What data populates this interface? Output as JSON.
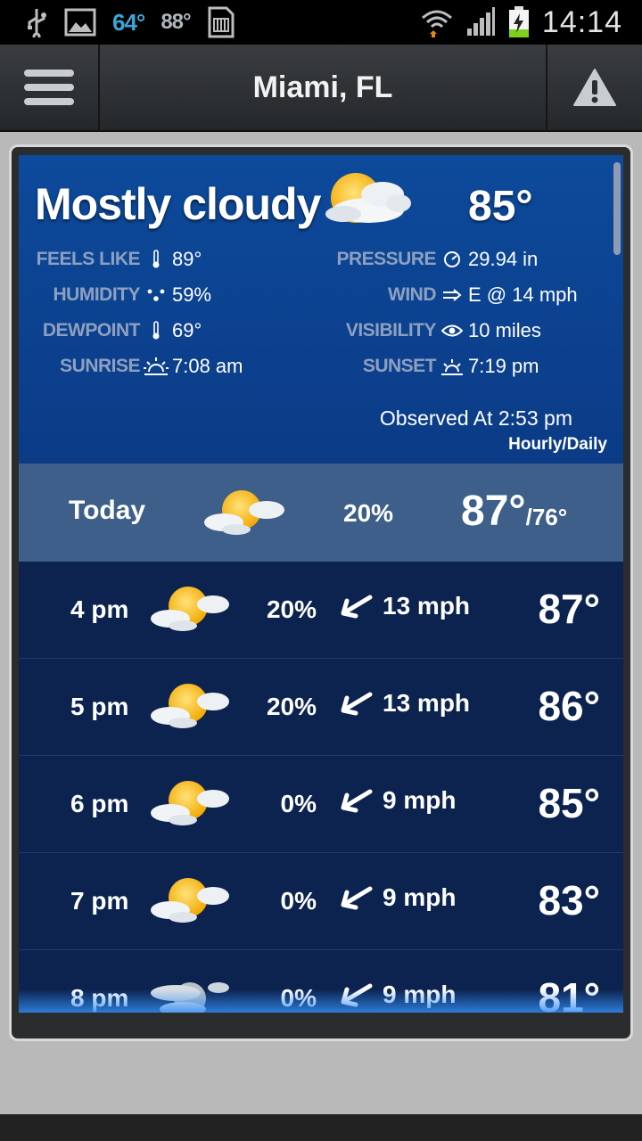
{
  "status_bar": {
    "temp_primary": "64°",
    "temp_secondary": "88°",
    "time": "14:14",
    "icons": [
      "usb-icon",
      "image-icon",
      "sd-card-icon",
      "wifi-icon",
      "signal-icon",
      "battery-charging-icon"
    ]
  },
  "header": {
    "title": "Miami, FL",
    "menu_icon": "hamburger-menu-icon",
    "alert_icon": "warning-icon"
  },
  "current": {
    "condition": "Mostly cloudy",
    "temperature": "85°",
    "icon": "mostly-cloudy-icon",
    "stats_left": [
      {
        "label": "FEELS LIKE",
        "icon": "thermometer-icon",
        "value": "89°"
      },
      {
        "label": "HUMIDITY",
        "icon": "humidity-icon",
        "value": "59%"
      },
      {
        "label": "DEWPOINT",
        "icon": "thermometer-icon",
        "value": "69°"
      },
      {
        "label": "SUNRISE",
        "icon": "sunrise-icon",
        "value": "7:08 am"
      }
    ],
    "stats_right": [
      {
        "label": "PRESSURE",
        "icon": "gauge-icon",
        "value": "29.94 in"
      },
      {
        "label": "WIND",
        "icon": "wind-icon",
        "value": "E @ 14 mph"
      },
      {
        "label": "VISIBILITY",
        "icon": "eye-icon",
        "value": "10 miles"
      },
      {
        "label": "SUNSET",
        "icon": "sunset-icon",
        "value": "7:19 pm"
      }
    ],
    "observed": "Observed At 2:53 pm",
    "toggle_label": "Hourly/Daily"
  },
  "today": {
    "label": "Today",
    "icon": "mostly-cloudy-icon",
    "precip": "20%",
    "high": "87°",
    "low": "/76°"
  },
  "hourly": [
    {
      "time": "4 pm",
      "icon": "mostly-cloudy-icon",
      "precip": "20%",
      "wind": "13 mph",
      "temp": "87°"
    },
    {
      "time": "5 pm",
      "icon": "mostly-cloudy-icon",
      "precip": "20%",
      "wind": "13 mph",
      "temp": "86°"
    },
    {
      "time": "6 pm",
      "icon": "mostly-cloudy-icon",
      "precip": "0%",
      "wind": "9 mph",
      "temp": "85°"
    },
    {
      "time": "7 pm",
      "icon": "mostly-cloudy-icon",
      "precip": "0%",
      "wind": "9 mph",
      "temp": "83°"
    },
    {
      "time": "8 pm",
      "icon": "partly-cloudy-night-icon",
      "precip": "0%",
      "wind": "9 mph",
      "temp": "81°"
    }
  ],
  "colors": {
    "current_bg": "#0d4a9b",
    "today_bg": "#3d5f8a",
    "hourly_bg": "#0c2350",
    "label": "#8ea0c0",
    "clock_temp_accent": "#3aa6d6"
  }
}
